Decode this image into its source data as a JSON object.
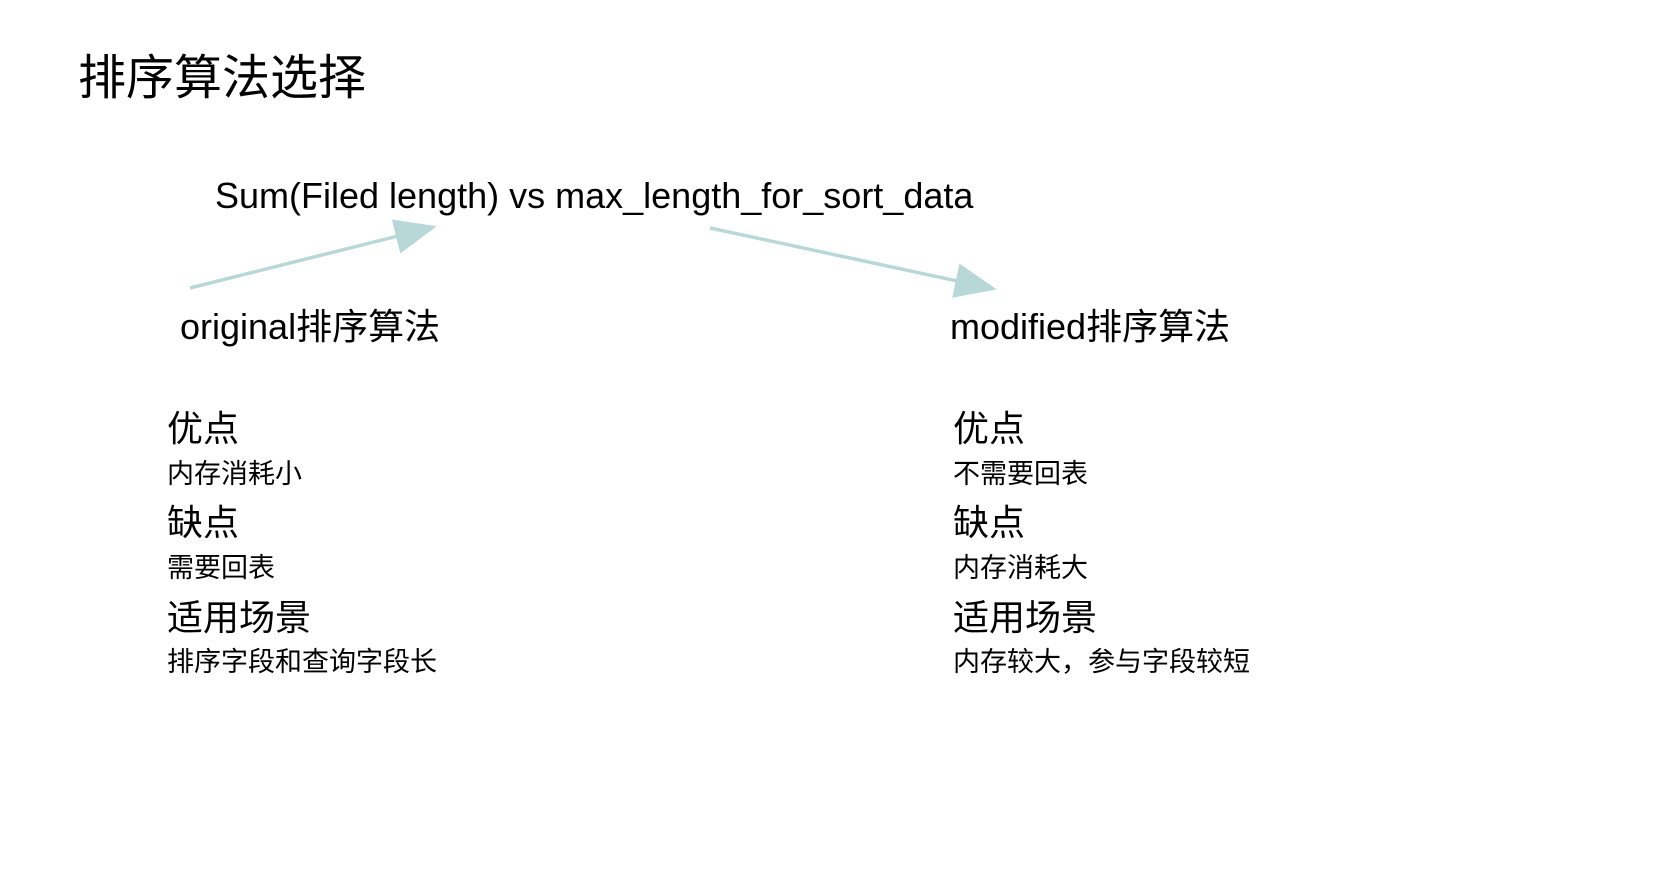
{
  "title": "排序算法选择",
  "comparison_header": "Sum(Filed length)  vs max_length_for_sort_data",
  "left": {
    "algo_label": "original排序算法",
    "pros_label": "优点",
    "pros_text": "内存消耗小",
    "cons_label": "缺点",
    "cons_text": "需要回表",
    "scenario_label": "适用场景",
    "scenario_text": "排序字段和查询字段长"
  },
  "right": {
    "algo_label": "modified排序算法",
    "pros_label": "优点",
    "pros_text": "不需要回表",
    "cons_label": "缺点",
    "cons_text": "内存消耗大",
    "scenario_label": "适用场景",
    "scenario_text": "内存较大，参与字段较短"
  }
}
